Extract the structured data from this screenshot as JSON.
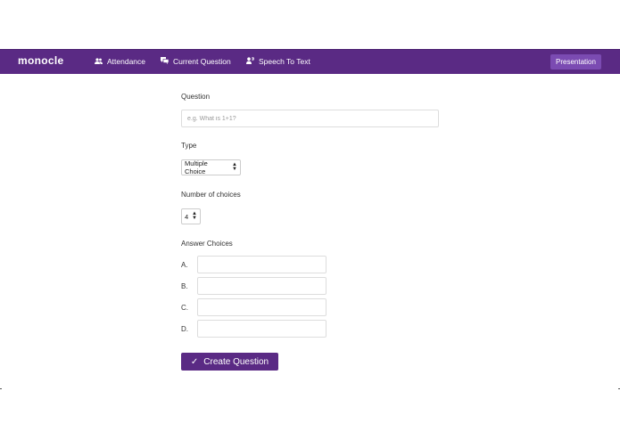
{
  "navbar": {
    "brand": "monocle",
    "items": [
      {
        "label": "Attendance",
        "icon": "people-icon"
      },
      {
        "label": "Current Question",
        "icon": "chat-icon"
      },
      {
        "label": "Speech To Text",
        "icon": "speech-icon"
      }
    ],
    "presentation_label": "Presentation"
  },
  "form": {
    "question_label": "Question",
    "question_placeholder": "e.g. What is 1+1?",
    "question_value": "",
    "type_label": "Type",
    "type_value": "Multiple Choice",
    "num_choices_label": "Number of choices",
    "num_choices_value": "4",
    "answers_label": "Answer Choices",
    "choices": [
      {
        "letter": "A.",
        "value": ""
      },
      {
        "letter": "B.",
        "value": ""
      },
      {
        "letter": "C.",
        "value": ""
      },
      {
        "letter": "D.",
        "value": ""
      }
    ],
    "submit_label": "Create Question"
  },
  "colors": {
    "navbar": "#5a2a84",
    "presentation_button": "#7b4bb2",
    "primary_button": "#5a2a84"
  }
}
